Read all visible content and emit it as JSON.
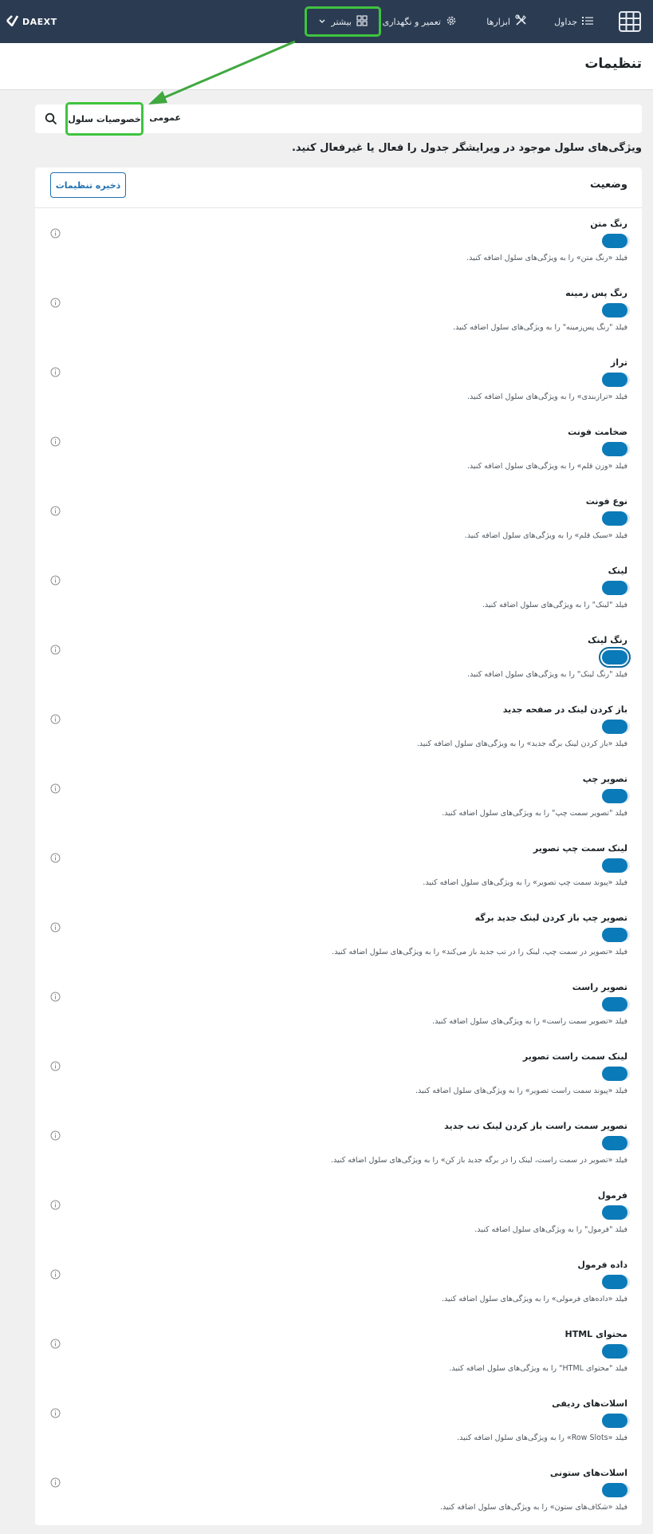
{
  "app": {
    "logo_text": "DAEXT",
    "nav": {
      "tables": "جداول",
      "tools": "ابزارها",
      "maintenance": "تعمیر و نگهداری",
      "more": "بیشتر"
    }
  },
  "page": {
    "title": "تنظیمات",
    "tabs": {
      "general": "عمومی",
      "cell_properties": "خصوصیات سلول"
    },
    "description": "ویژگی‌های سلول موجود در ویرایشگر جدول را فعال یا غیرفعال کنید.",
    "panel_title": "وضعیت",
    "save_label": "ذخیره تنظیمات"
  },
  "options": [
    {
      "label": "رنگ متن",
      "help": "فیلد «رنگ متن» را به ویژگی‌های سلول اضافه کنید.",
      "enabled": true
    },
    {
      "label": "رنگ پس زمینه",
      "help": "فیلد \"رنگ پس‌زمینه\" را به ویژگی‌های سلول اضافه کنید.",
      "enabled": true
    },
    {
      "label": "تراز",
      "help": "فیلد «ترازبندی» را به ویژگی‌های سلول اضافه کنید.",
      "enabled": true
    },
    {
      "label": "ضخامت فونت",
      "help": "فیلد «وزن قلم» را به ویژگی‌های سلول اضافه کنید.",
      "enabled": true
    },
    {
      "label": "نوع فونت",
      "help": "فیلد «سبک قلم» را به ویژگی‌های سلول اضافه کنید.",
      "enabled": true
    },
    {
      "label": "لینک",
      "help": "فیلد \"لینک\" را به ویژگی‌های سلول اضافه کنید.",
      "enabled": true
    },
    {
      "label": "رنگ لینک",
      "help": "فیلد \"رنگ لینک\" را به ویژگی‌های سلول اضافه کنید.",
      "enabled": true
    },
    {
      "label": "باز کردن لینک در صفحه جدید",
      "help": "فیلد «باز کردن لینک برگه جدید» را به ویژگی‌های سلول اضافه کنید.",
      "enabled": true
    },
    {
      "label": "تصویر چپ",
      "help": "فیلد \"تصویر سمت چپ\" را به ویژگی‌های سلول اضافه کنید.",
      "enabled": true
    },
    {
      "label": "لینک سمت چپ تصویر",
      "help": "فیلد «پیوند سمت چپ تصویر» را به ویژگی‌های سلول اضافه کنید.",
      "enabled": true
    },
    {
      "label": "تصویر چپ باز کردن لینک جدید برگه",
      "help": "فیلد «تصویر در سمت چپ، لینک را در تب جدید باز می‌کند» را به ویژگی‌های سلول اضافه کنید.",
      "enabled": true
    },
    {
      "label": "تصویر راست",
      "help": "فیلد «تصویر سمت راست» را به ویژگی‌های سلول اضافه کنید.",
      "enabled": true
    },
    {
      "label": "لینک سمت راست تصویر",
      "help": "فیلد «پیوند سمت راست تصویر» را به ویژگی‌های سلول اضافه کنید.",
      "enabled": true
    },
    {
      "label": "تصویر سمت راست باز کردن لینک تب جدید",
      "help": "فیلد «تصویر در سمت راست، لینک را در برگه جدید باز کن» را به ویژگی‌های سلول اضافه کنید.",
      "enabled": true
    },
    {
      "label": "فرمول",
      "help": "فیلد \"فرمول\" را به ویژگی‌های سلول اضافه کنید.",
      "enabled": true
    },
    {
      "label": "داده فرمول",
      "help": "فیلد «داده‌های فرمولی» را به ویژگی‌های سلول اضافه کنید.",
      "enabled": true
    },
    {
      "label": "محتوای HTML",
      "help": "فیلد \"محتوای HTML\" را به ویژگی‌های سلول اضافه کنید.",
      "enabled": true
    },
    {
      "label": "اسلات‌های ردیفی",
      "help": "فیلد «Row Slots» را به ویژگی‌های سلول اضافه کنید.",
      "enabled": true
    },
    {
      "label": "اسلات‌های ستونی",
      "help": "فیلد «شکاف‌های ستون» را به ویژگی‌های سلول اضافه کنید.",
      "enabled": true
    }
  ],
  "colors": {
    "topbar": "#2b3b52",
    "accent": "#0b7ab8",
    "annotation": "#3fc43f"
  }
}
